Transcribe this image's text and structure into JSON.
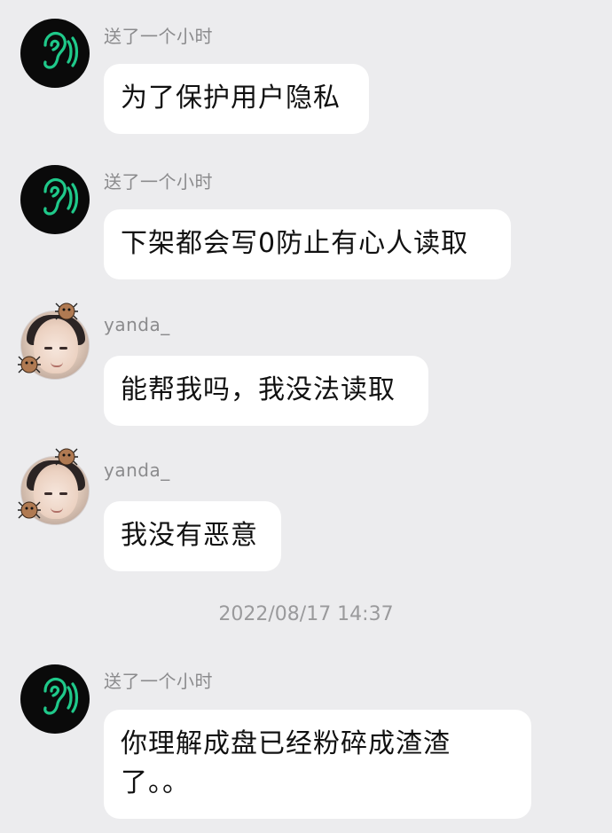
{
  "messages": [
    {
      "sender": "送了一个小时",
      "text": "为了保护用户隐私",
      "avatar": "ear-icon"
    },
    {
      "sender": "送了一个小时",
      "text": "下架都会写0防止有心人读取",
      "avatar": "ear-icon"
    },
    {
      "sender": "yanda_",
      "text": "能帮我吗，我没法读取",
      "avatar": "user-photo"
    },
    {
      "sender": "yanda_",
      "text": "我没有恶意",
      "avatar": "user-photo"
    },
    {
      "sender": "送了一个小时",
      "text": "你理解成盘已经粉碎成渣渣\n了。。",
      "avatar": "ear-icon"
    }
  ],
  "timestamp": "2022/08/17 14:37",
  "colors": {
    "background": "#ececee",
    "bubble": "#ffffff",
    "ear_icon": "#1fc98a"
  }
}
